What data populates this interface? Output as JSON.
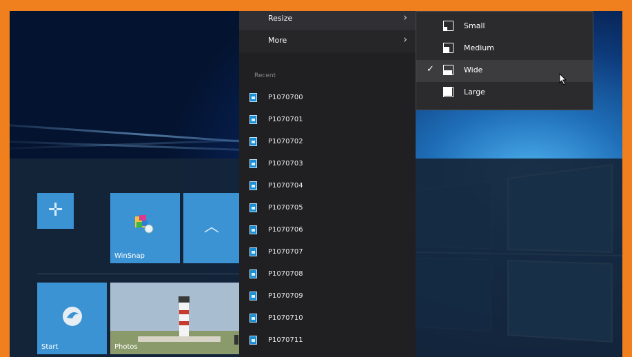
{
  "context_menu": {
    "resize_label": "Resize",
    "more_label": "More",
    "recent_header": "Recent",
    "recent_items": [
      "P1070700",
      "P1070701",
      "P1070702",
      "P1070703",
      "P1070704",
      "P1070705",
      "P1070706",
      "P1070707",
      "P1070708",
      "P1070709",
      "P1070710",
      "P1070711"
    ]
  },
  "resize_submenu": {
    "small_label": "Small",
    "medium_label": "Medium",
    "wide_label": "Wide",
    "large_label": "Large",
    "selected": "Wide",
    "check_glyph": "✓"
  },
  "tiles": {
    "winsnap_label": "WinSnap",
    "start_label": "Start",
    "photos_label": "Photos"
  },
  "colors": {
    "frame": "#f07f1e",
    "tile": "#3b93d3",
    "menu_bg": "#202022",
    "submenu_bg": "#2b2b2d"
  }
}
